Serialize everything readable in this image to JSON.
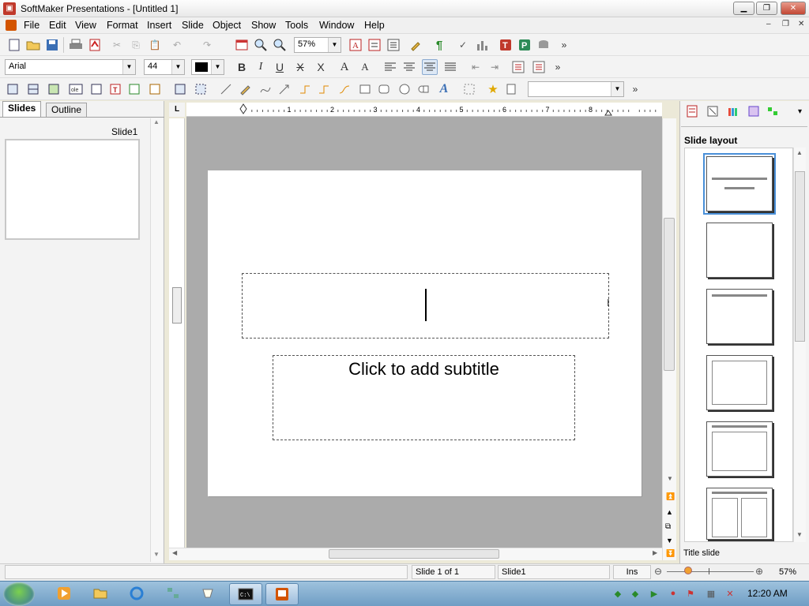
{
  "window": {
    "title": "SoftMaker Presentations - [Untitled 1]",
    "controls": {
      "minimize": "▁",
      "maximize": "❐",
      "close": "✕"
    }
  },
  "menu": {
    "items": [
      "File",
      "Edit",
      "View",
      "Format",
      "Insert",
      "Slide",
      "Object",
      "Show",
      "Tools",
      "Window",
      "Help"
    ],
    "doc_controls": [
      "–",
      "❐",
      "✕"
    ]
  },
  "toolbar1": {
    "zoom_value": "57%",
    "overflow": "»"
  },
  "toolbar2": {
    "font_name": "Arial",
    "font_size": "44",
    "bold": "B",
    "italic": "I",
    "underline": "U",
    "strike": "X",
    "strike2": "X",
    "grow": "A",
    "shrink": "A",
    "overflow": "»"
  },
  "toolbar3": {
    "overflow": "»",
    "style_value": ""
  },
  "left_panel": {
    "tabs": [
      "Slides",
      "Outline"
    ],
    "active_tab": "Slides",
    "slide_label": "Slide1"
  },
  "ruler": {
    "corner": "L",
    "ticks": [
      "1",
      "2",
      "3",
      "4",
      "5",
      "6",
      "7",
      "8"
    ]
  },
  "slide": {
    "title_text": "",
    "subtitle_placeholder": "Click to add subtitle"
  },
  "right_panel": {
    "heading": "Slide layout",
    "layouts": [
      "title",
      "blank",
      "title-only",
      "content",
      "title-content",
      "two-content"
    ],
    "selected_layout_name": "Title slide",
    "overflow": "▾"
  },
  "status": {
    "slide_pos": "Slide 1 of 1",
    "slide_name": "Slide1",
    "mode": "Ins",
    "zoom": "57%"
  },
  "taskbar": {
    "clock": "12:20 AM"
  },
  "colors": {
    "workspace": "#ababab",
    "accent": "#4a90d9"
  }
}
